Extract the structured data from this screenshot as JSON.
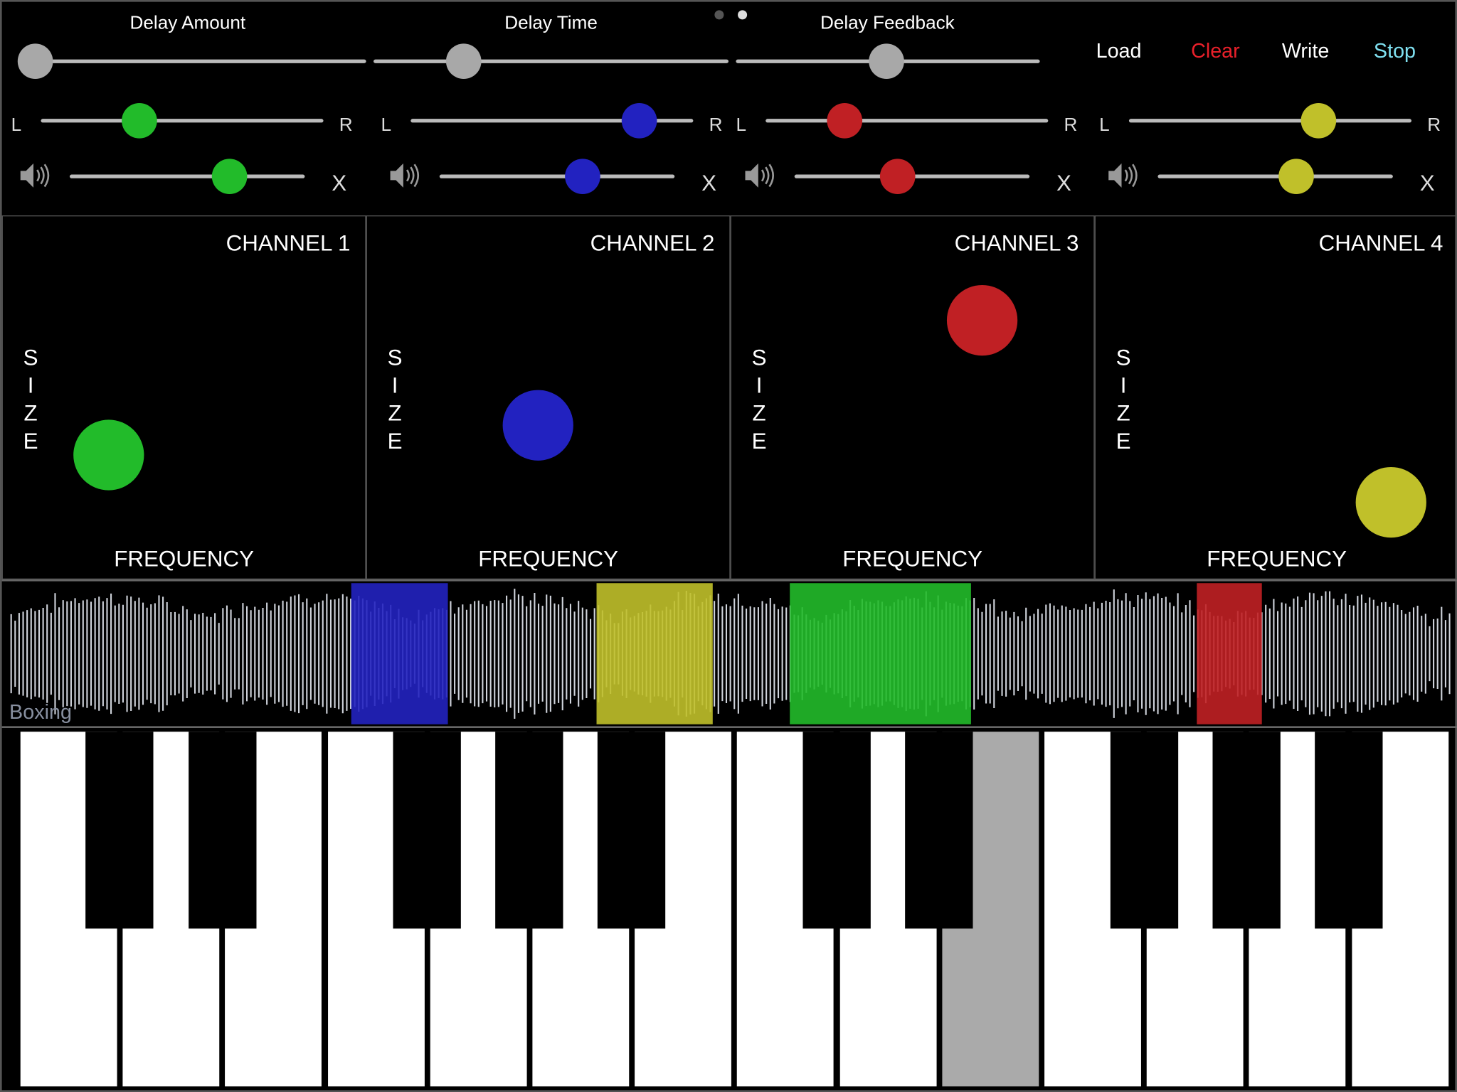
{
  "page_dots": {
    "count": 2,
    "active": 1
  },
  "delay": [
    {
      "label": "Delay Amount",
      "value": 0.0
    },
    {
      "label": "Delay Time",
      "value": 0.27
    },
    {
      "label": "Delay Feedback",
      "value": 0.51
    }
  ],
  "buttons": {
    "load": "Load",
    "clear": "Clear",
    "write": "Write",
    "stop": "Stop"
  },
  "colors": {
    "clear": "#e8202a",
    "stop": "#7fe0f0",
    "knob_gray": "#a8a8a8"
  },
  "pan_labels": {
    "left": "L",
    "right": "R"
  },
  "mute_label": "X",
  "axis": {
    "size_letters": [
      "S",
      "I",
      "Z",
      "E"
    ],
    "frequency": "FREQUENCY"
  },
  "channels": [
    {
      "name": "CHANNEL 1",
      "color": "#22bb2a",
      "pan": 0.35,
      "volume": 0.68,
      "frequency": 0.29,
      "size": 0.34
    },
    {
      "name": "CHANNEL 2",
      "color": "#2222c0",
      "pan": 0.81,
      "volume": 0.61,
      "frequency": 0.47,
      "size": 0.42
    },
    {
      "name": "CHANNEL 3",
      "color": "#c02024",
      "pan": 0.28,
      "volume": 0.44,
      "frequency": 0.69,
      "size": 0.71
    },
    {
      "name": "CHANNEL 4",
      "color": "#c0c02a",
      "pan": 0.67,
      "volume": 0.59,
      "frequency": 0.81,
      "size": 0.21
    }
  ],
  "waveform": {
    "sample_name": "Boxing",
    "regions": [
      {
        "channel": 2,
        "start": 0.24,
        "end": 0.306
      },
      {
        "channel": 4,
        "start": 0.408,
        "end": 0.488
      },
      {
        "channel": 1,
        "start": 0.541,
        "end": 0.665
      },
      {
        "channel": 3,
        "start": 0.82,
        "end": 0.865
      }
    ]
  },
  "keyboard": {
    "white_keys": 14,
    "pressed_white_key": 9,
    "pressed_color": "#aaaaaa"
  }
}
